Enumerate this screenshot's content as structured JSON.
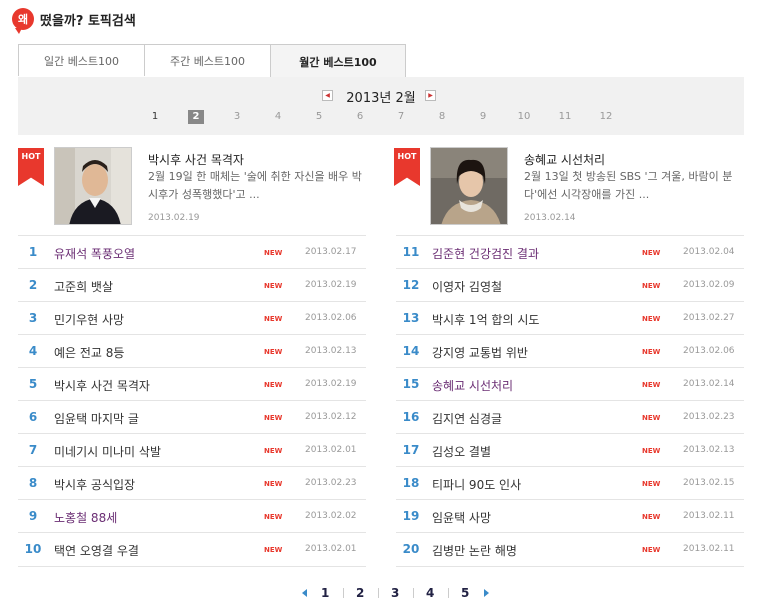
{
  "header": {
    "logo": "왜",
    "title": "떴을까? 토픽검색"
  },
  "tabs": [
    {
      "label": "일간 베스트100",
      "active": false
    },
    {
      "label": "주간 베스트100",
      "active": false
    },
    {
      "label": "월간 베스트100",
      "active": true
    }
  ],
  "month": {
    "label": "2013년 2월",
    "prev": "◀",
    "next": "▶",
    "days": [
      "1",
      "2",
      "3",
      "4",
      "5",
      "6",
      "7",
      "8",
      "9",
      "10",
      "11",
      "12"
    ],
    "active_day": "2"
  },
  "featured": [
    {
      "badge": "HOT",
      "title": "박시후 사건 목격자",
      "desc": "2월 19일 한 매체는 '술에 취한 자신을 배우 박시후가 성폭행했다'고 ...",
      "date": "2013.02.19"
    },
    {
      "badge": "HOT",
      "title": "송혜교 시선처리",
      "desc": "2월 13일 첫 방송된 SBS '그 겨울, 바람이 분다'에선 시각장애를 가진 ...",
      "date": "2013.02.14"
    }
  ],
  "new_label": "NEW",
  "list_left": [
    {
      "rank": "1",
      "keyword": "유재석 폭풍오열",
      "date": "2013.02.17",
      "visited": true
    },
    {
      "rank": "2",
      "keyword": "고준희 뱃살",
      "date": "2013.02.19",
      "visited": false
    },
    {
      "rank": "3",
      "keyword": "민기우현 사망",
      "date": "2013.02.06",
      "visited": false
    },
    {
      "rank": "4",
      "keyword": "예은 전교 8등",
      "date": "2013.02.13",
      "visited": false
    },
    {
      "rank": "5",
      "keyword": "박시후 사건 목격자",
      "date": "2013.02.19",
      "visited": false
    },
    {
      "rank": "6",
      "keyword": "임윤택 마지막 글",
      "date": "2013.02.12",
      "visited": false
    },
    {
      "rank": "7",
      "keyword": "미네기시 미나미 삭발",
      "date": "2013.02.01",
      "visited": false
    },
    {
      "rank": "8",
      "keyword": "박시후 공식입장",
      "date": "2013.02.23",
      "visited": false
    },
    {
      "rank": "9",
      "keyword": "노홍철 88세",
      "date": "2013.02.02",
      "visited": true
    },
    {
      "rank": "10",
      "keyword": "택연 오영결 우결",
      "date": "2013.02.01",
      "visited": false
    }
  ],
  "list_right": [
    {
      "rank": "11",
      "keyword": "김준현 건강검진 결과",
      "date": "2013.02.04",
      "visited": true
    },
    {
      "rank": "12",
      "keyword": "이영자 김영철",
      "date": "2013.02.09",
      "visited": false
    },
    {
      "rank": "13",
      "keyword": "박시후 1억 합의 시도",
      "date": "2013.02.27",
      "visited": false
    },
    {
      "rank": "14",
      "keyword": "강지영 교통법 위반",
      "date": "2013.02.06",
      "visited": false
    },
    {
      "rank": "15",
      "keyword": "송혜교 시선처리",
      "date": "2013.02.14",
      "visited": true
    },
    {
      "rank": "16",
      "keyword": "김지연 심경글",
      "date": "2013.02.23",
      "visited": false
    },
    {
      "rank": "17",
      "keyword": "김성오 결별",
      "date": "2013.02.13",
      "visited": false
    },
    {
      "rank": "18",
      "keyword": "티파니 90도 인사",
      "date": "2013.02.15",
      "visited": false
    },
    {
      "rank": "19",
      "keyword": "임윤택 사망",
      "date": "2013.02.11",
      "visited": false
    },
    {
      "rank": "20",
      "keyword": "김병만 논란 해명",
      "date": "2013.02.11",
      "visited": false
    }
  ],
  "pagination": {
    "pages": [
      "1",
      "2",
      "3",
      "4",
      "5"
    ]
  },
  "colors": {
    "accent": "#e8382d",
    "rank": "#3a8bc9",
    "visited": "#6b2e74"
  }
}
